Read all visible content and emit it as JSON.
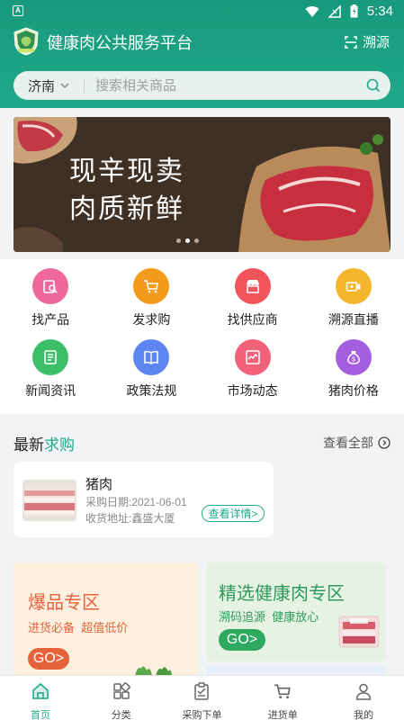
{
  "status_bar": {
    "time": "5:34",
    "notification_letter": "A"
  },
  "header": {
    "title": "健康肉公共服务平台",
    "trace_label": "溯源"
  },
  "search": {
    "city": "济南",
    "placeholder": "搜索相关商品"
  },
  "banner": {
    "line1": "现辛现卖",
    "line2": "肉质新鲜",
    "slides": 3,
    "active_slide": 1
  },
  "grid": [
    {
      "label": "找产品",
      "icon": "find-product-icon",
      "color": "#f0679a"
    },
    {
      "label": "发求购",
      "icon": "cart-icon",
      "color": "#f49a1c"
    },
    {
      "label": "找供应商",
      "icon": "supplier-store-icon",
      "color": "#f2545b"
    },
    {
      "label": "溯源直播",
      "icon": "live-video-icon",
      "color": "#f5b62b"
    },
    {
      "label": "新闻资讯",
      "icon": "news-icon",
      "color": "#3dbf6a"
    },
    {
      "label": "政策法规",
      "icon": "book-icon",
      "color": "#5d86f2"
    },
    {
      "label": "市场动态",
      "icon": "market-trend-icon",
      "color": "#f2617a"
    },
    {
      "label": "猪肉价格",
      "icon": "money-bag-icon",
      "color": "#a45ee0"
    }
  ],
  "latest": {
    "title_prefix": "最新",
    "title_accent": "求购",
    "view_all": "查看全部",
    "card": {
      "name": "猪肉",
      "date_label": "采购日期:",
      "date": "2021-06-01",
      "address_label": "收货地址:",
      "address": "鑫盛大厦",
      "button": "查看详情>"
    }
  },
  "promo_left": {
    "title": "爆品专区",
    "sub1": "进货必备",
    "sub2": "超值低价",
    "go": "GO>"
  },
  "promo_right": {
    "title": "精选健康肉专区",
    "sub1": "溯码追源",
    "sub2": "健康放心",
    "go": "GO>"
  },
  "tabs": [
    {
      "label": "首页",
      "icon": "home-icon",
      "active": true
    },
    {
      "label": "分类",
      "icon": "category-icon",
      "active": false
    },
    {
      "label": "采购下单",
      "icon": "order-clipboard-icon",
      "active": false
    },
    {
      "label": "进货单",
      "icon": "cart-icon",
      "active": false
    },
    {
      "label": "我的",
      "icon": "profile-icon",
      "active": false
    }
  ],
  "colors": {
    "brand": "#20a989",
    "promo_orange": "#e6623c",
    "promo_green": "#2f9a5b"
  }
}
